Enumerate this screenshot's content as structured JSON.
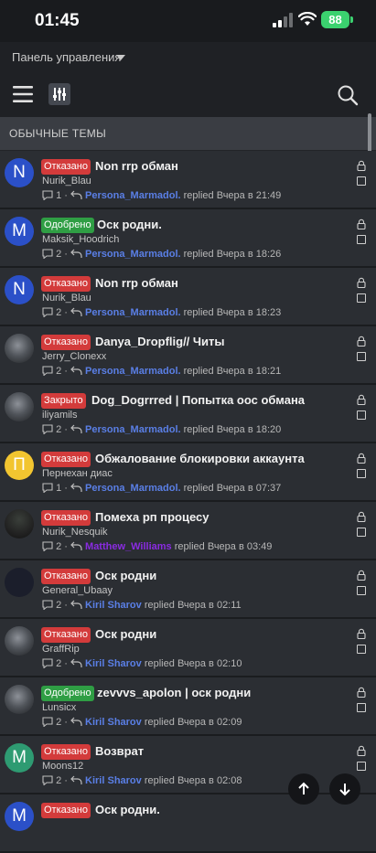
{
  "status_bar": {
    "time": "01:45",
    "battery": "88"
  },
  "panel": {
    "label": "Панель управления"
  },
  "section": {
    "title": "ОБЫЧНЫЕ ТЕМЫ"
  },
  "colors": {
    "rejected": "#d33b3b",
    "approved": "#2f9e44",
    "closed": "#d33b3b",
    "link_blue": "#5a7fe6",
    "link_purple": "#8a2be2"
  },
  "threads": [
    {
      "badge": "Отказано",
      "badge_type": "rejected",
      "title": "Non rrp обман",
      "author": "Nurik_Blau",
      "replies": "1",
      "last_poster": "Persona_Marmadol.",
      "last_poster_color": "blue",
      "replied_text": "replied",
      "time": "Вчера в 21:49",
      "avatar": {
        "letter": "N",
        "color": "#2b50c8",
        "style": "letter"
      }
    },
    {
      "badge": "Одобрено",
      "badge_type": "approved",
      "title": "Оск родни.",
      "author": "Maksik_Hoodrich",
      "replies": "2",
      "last_poster": "Persona_Marmadol.",
      "last_poster_color": "blue",
      "replied_text": "replied",
      "time": "Вчера в 18:26",
      "avatar": {
        "letter": "M",
        "color": "#2b50c8",
        "style": "letter"
      }
    },
    {
      "badge": "Отказано",
      "badge_type": "rejected",
      "title": "Non rrp обман",
      "author": "Nurik_Blau",
      "replies": "2",
      "last_poster": "Persona_Marmadol.",
      "last_poster_color": "blue",
      "replied_text": "replied",
      "time": "Вчера в 18:23",
      "avatar": {
        "letter": "N",
        "color": "#2b50c8",
        "style": "letter"
      }
    },
    {
      "badge": "Отказано",
      "badge_type": "rejected",
      "title": "Danya_Dropflig// Читы",
      "author": "Jerry_Clonexx",
      "replies": "2",
      "last_poster": "Persona_Marmadol.",
      "last_poster_color": "blue",
      "replied_text": "replied",
      "time": "Вчера в 18:21",
      "avatar": {
        "letter": "",
        "color": "",
        "style": "photo"
      }
    },
    {
      "badge": "Закрыто",
      "badge_type": "closed",
      "title": "Dog_Dogrrred | Попытка оос обмана",
      "author": "iliyamils",
      "replies": "2",
      "last_poster": "Persona_Marmadol.",
      "last_poster_color": "blue",
      "replied_text": "replied",
      "time": "Вчера в 18:20",
      "avatar": {
        "letter": "",
        "color": "",
        "style": "photo"
      }
    },
    {
      "badge": "Отказано",
      "badge_type": "rejected",
      "title": "Обжалование блокировки аккаунта",
      "author": "Пернехан диас",
      "replies": "1",
      "last_poster": "Persona_Marmadol.",
      "last_poster_color": "blue",
      "replied_text": "replied",
      "time": "Вчера в 07:37",
      "avatar": {
        "letter": "П",
        "color": "#f2c530",
        "style": "letter"
      }
    },
    {
      "badge": "Отказано",
      "badge_type": "rejected",
      "title": "Помеха рп процесу",
      "author": "Nurik_Nesquik",
      "replies": "2",
      "last_poster": "Matthew_Williams",
      "last_poster_color": "purple",
      "replied_text": "replied",
      "time": "Вчера в 03:49",
      "avatar": {
        "letter": "",
        "color": "",
        "style": "dark"
      }
    },
    {
      "badge": "Отказано",
      "badge_type": "rejected",
      "title": "Оск родни",
      "author": "General_Ubaay",
      "replies": "2",
      "last_poster": "Kiril Sharov",
      "last_poster_color": "blue",
      "replied_text": "replied",
      "time": "Вчера в 02:11",
      "avatar": {
        "letter": "",
        "color": "",
        "style": "navy"
      }
    },
    {
      "badge": "Отказано",
      "badge_type": "rejected",
      "title": "Оск родни",
      "author": "GraffRip",
      "replies": "2",
      "last_poster": "Kiril Sharov",
      "last_poster_color": "blue",
      "replied_text": "replied",
      "time": "Вчера в 02:10",
      "avatar": {
        "letter": "",
        "color": "",
        "style": "photo"
      }
    },
    {
      "badge": "Одобрено",
      "badge_type": "approved",
      "title": "zevvvs_apolon | оск родни",
      "author": "Lunsicx",
      "replies": "2",
      "last_poster": "Kiril Sharov",
      "last_poster_color": "blue",
      "replied_text": "replied",
      "time": "Вчера в 02:09",
      "avatar": {
        "letter": "",
        "color": "",
        "style": "photo"
      }
    },
    {
      "badge": "Отказано",
      "badge_type": "rejected",
      "title": "Возврат",
      "author": "Moons12",
      "replies": "2",
      "last_poster": "Kiril Sharov",
      "last_poster_color": "blue",
      "replied_text": "replied",
      "time": "Вчера в 02:08",
      "avatar": {
        "letter": "M",
        "color": "#2e9b72",
        "style": "letter"
      }
    },
    {
      "badge": "Отказано",
      "badge_type": "rejected",
      "title": "Оск родни.",
      "author": "",
      "replies": "",
      "last_poster": "",
      "last_poster_color": "blue",
      "replied_text": "",
      "time": "",
      "avatar": {
        "letter": "M",
        "color": "#2b50c8",
        "style": "letter"
      }
    }
  ],
  "icons": {
    "menu": "hamburger-icon",
    "filter": "filter-sliders-icon",
    "search": "search-icon",
    "lock": "lock-icon",
    "replies": "comment-icon",
    "last_reply": "reply-arrows-icon",
    "scroll_up": "arrow-up-icon",
    "scroll_down": "arrow-down-icon"
  }
}
